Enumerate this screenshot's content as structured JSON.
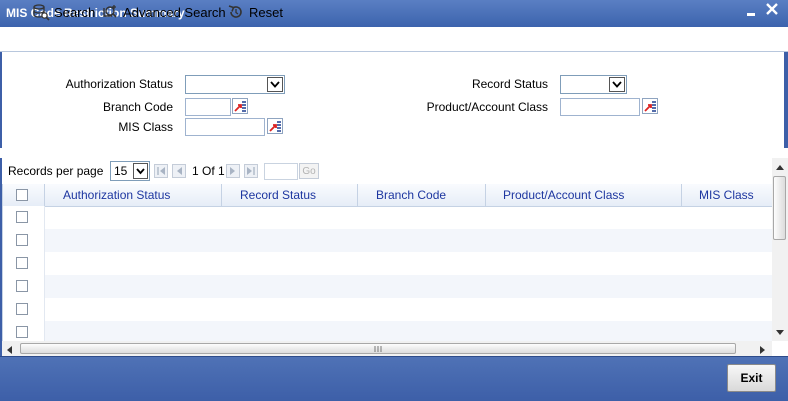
{
  "window": {
    "title": "MIS Code Restriction Summary",
    "minimize_glyph": "▂",
    "close_glyph": "✕"
  },
  "toolbar": {
    "search_label": "Search",
    "advanced_search_label": "Advanced Search",
    "reset_label": "Reset"
  },
  "criteria": {
    "authorization_status_label": "Authorization Status",
    "authorization_status_value": "",
    "record_status_label": "Record Status",
    "record_status_value": "",
    "branch_code_label": "Branch Code",
    "branch_code_value": "",
    "product_account_class_label": "Product/Account Class",
    "product_account_class_value": "",
    "mis_class_label": "MIS Class",
    "mis_class_value": ""
  },
  "pager": {
    "records_per_page_label": "Records per page",
    "records_per_page_value": "15",
    "page_info": "1 Of 1",
    "page_input_value": "",
    "go_label": "Go"
  },
  "grid": {
    "columns": [
      "Authorization Status",
      "Record Status",
      "Branch Code",
      "Product/Account Class",
      "MIS Class"
    ],
    "row_count": 6
  },
  "footer": {
    "exit_label": "Exit"
  },
  "colors": {
    "title_bar": "#3c63ad",
    "header_text": "#1d36a0",
    "footer": "#3d5fa8"
  }
}
